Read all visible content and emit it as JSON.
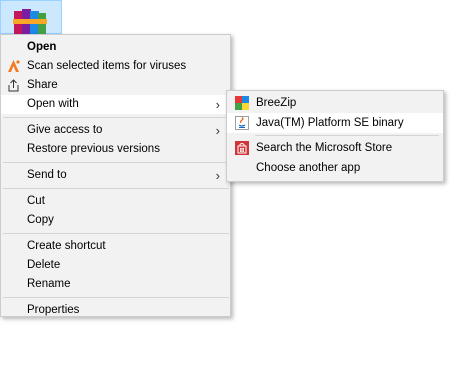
{
  "context_menu": {
    "open": "Open",
    "scan": "Scan selected items for viruses",
    "share": "Share",
    "open_with": "Open with",
    "give_access_to": "Give access to",
    "restore_previous_versions": "Restore previous versions",
    "send_to": "Send to",
    "cut": "Cut",
    "copy": "Copy",
    "create_shortcut": "Create shortcut",
    "delete": "Delete",
    "rename": "Rename",
    "properties": "Properties",
    "submenu_arrow": "›"
  },
  "submenu": {
    "breezip": "BreeZip",
    "java": "Java(TM) Platform SE binary",
    "store": "Search the Microsoft Store",
    "choose_another": "Choose another app"
  },
  "colors": {
    "menu_background": "#f2f2f2",
    "highlight": "#ffffff",
    "selected_file": "#cce8ff",
    "avast_orange": "#f47a20",
    "store_red": "#d13438"
  },
  "icons": {
    "file": "winrar-archive-icon",
    "scan": "avast-icon",
    "share": "share-icon",
    "breezip": "breezip-icon",
    "java": "java-icon",
    "store": "microsoft-store-icon"
  }
}
